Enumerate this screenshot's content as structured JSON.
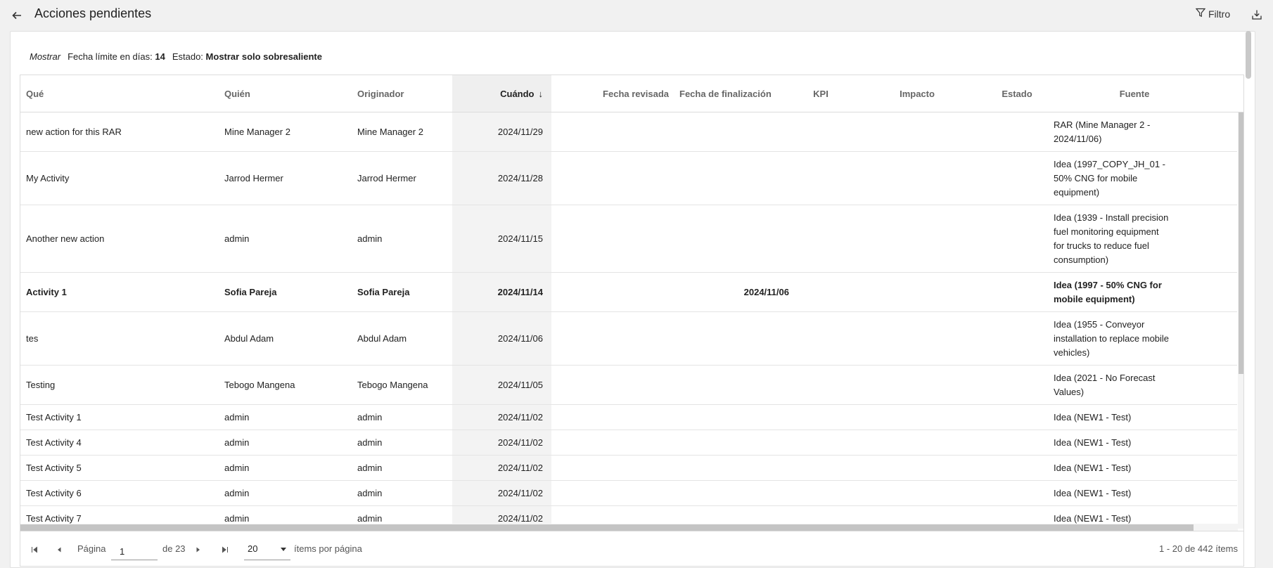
{
  "header": {
    "title": "Acciones pendientes",
    "filter_label": "Filtro"
  },
  "filter_summary": {
    "show_label": "Mostrar",
    "deadline_label": "Fecha límite en días:",
    "deadline_value": "14",
    "status_label": "Estado:",
    "status_value": "Mostrar solo sobresaliente"
  },
  "table": {
    "columns": [
      "Qué",
      "Quién",
      "Originador",
      "Cuándo",
      "Fecha revisada",
      "Fecha de finalización",
      "KPI",
      "Impacto",
      "Estado",
      "Fuente"
    ],
    "sort_indicator": "↓",
    "rows": [
      {
        "que": "new action for this RAR",
        "quien": "Mine Manager 2",
        "originador": "Mine Manager 2",
        "cuando": "2024/11/29",
        "finalizacion": "",
        "fuente": [
          "RAR (Mine Manager 2 -",
          "2024/11/06)"
        ]
      },
      {
        "que": "My Activity",
        "quien": "Jarrod Hermer",
        "originador": "Jarrod Hermer",
        "cuando": "2024/11/28",
        "finalizacion": "",
        "fuente": [
          "Idea (1997_COPY_JH_01 -",
          "50% CNG for mobile",
          "equipment)"
        ]
      },
      {
        "que": "Another new action",
        "quien": "admin",
        "originador": "admin",
        "cuando": "2024/11/15",
        "finalizacion": "",
        "fuente": [
          "Idea (1939 - Install precision",
          "fuel monitoring equipment",
          "for trucks to reduce fuel",
          "consumption)"
        ]
      },
      {
        "que": "Activity 1",
        "quien": "Sofia Pareja",
        "originador": "Sofia Pareja",
        "cuando": "2024/11/14",
        "finalizacion": "2024/11/06",
        "fuente": [
          "Idea (1997 - 50% CNG for",
          "mobile equipment)"
        ]
      },
      {
        "que": "tes",
        "quien": "Abdul Adam",
        "originador": "Abdul Adam",
        "cuando": "2024/11/06",
        "finalizacion": "",
        "fuente": [
          "Idea (1955 - Conveyor",
          "installation to replace mobile",
          "vehicles)"
        ]
      },
      {
        "que": "Testing",
        "quien": "Tebogo Mangena",
        "originador": "Tebogo Mangena",
        "cuando": "2024/11/05",
        "finalizacion": "",
        "fuente": [
          "Idea (2021 - No Forecast",
          "Values)"
        ]
      },
      {
        "que": "Test Activity 1",
        "quien": "admin",
        "originador": "admin",
        "cuando": "2024/11/02",
        "finalizacion": "",
        "fuente": [
          "Idea (NEW1 - Test)"
        ]
      },
      {
        "que": "Test Activity 4",
        "quien": "admin",
        "originador": "admin",
        "cuando": "2024/11/02",
        "finalizacion": "",
        "fuente": [
          "Idea (NEW1 - Test)"
        ]
      },
      {
        "que": "Test Activity 5",
        "quien": "admin",
        "originador": "admin",
        "cuando": "2024/11/02",
        "finalizacion": "",
        "fuente": [
          "Idea (NEW1 - Test)"
        ]
      },
      {
        "que": "Test Activity 6",
        "quien": "admin",
        "originador": "admin",
        "cuando": "2024/11/02",
        "finalizacion": "",
        "fuente": [
          "Idea (NEW1 - Test)"
        ]
      },
      {
        "que": "Test Activity 7",
        "quien": "admin",
        "originador": "admin",
        "cuando": "2024/11/02",
        "finalizacion": "",
        "fuente": [
          "Idea (NEW1 - Test)"
        ]
      }
    ]
  },
  "pager": {
    "page_label": "Página",
    "page_value": "1",
    "of_label": "de 23",
    "page_size": "20",
    "per_page_label": "ítems por página",
    "summary": "1 - 20 de 442 ítems"
  },
  "colors": {
    "sorted_column_bg": "#efefef",
    "border": "#dcdcdc",
    "scrollbar": "#c4c4c4"
  }
}
